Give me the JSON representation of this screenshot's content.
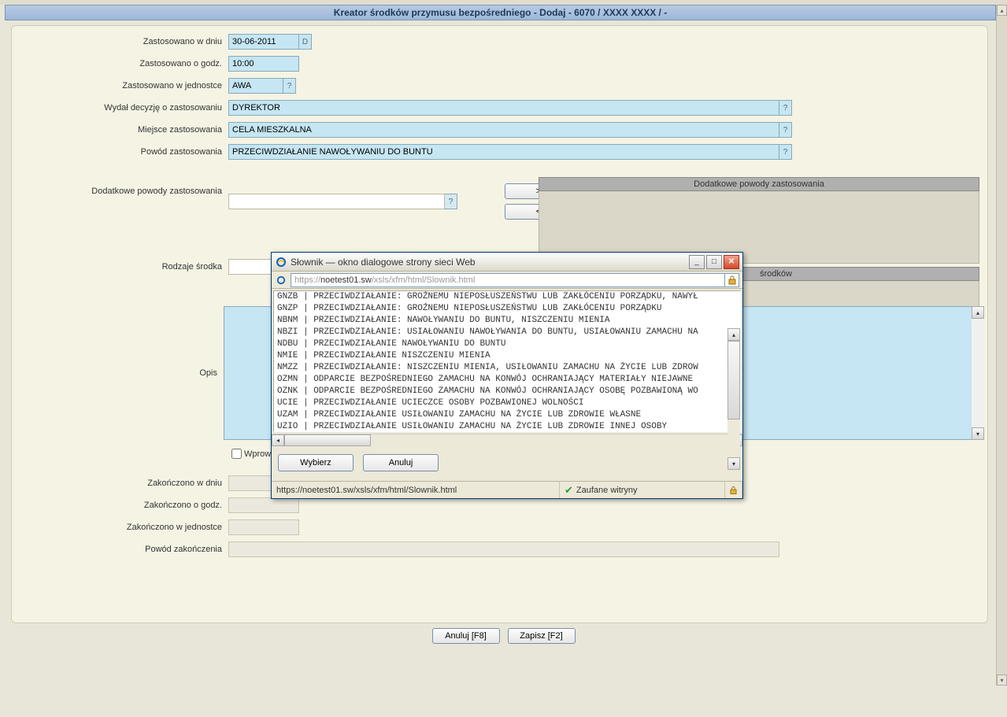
{
  "title": "Kreator środków przymusu bezpośredniego - Dodaj - 6070 / XXXX XXXX / -",
  "form": {
    "zastosowano_dniu": {
      "label": "Zastosowano w dniu",
      "value": "30-06-2011",
      "btn": "D"
    },
    "zastosowano_godz": {
      "label": "Zastosowano o godz.",
      "value": "10:00"
    },
    "zastosowano_jedn": {
      "label": "Zastosowano w jednostce",
      "value": "AWA",
      "btn": "?"
    },
    "wydal_decyzje": {
      "label": "Wydał decyzję o zastosowaniu",
      "value": "DYREKTOR",
      "btn": "?"
    },
    "miejsce": {
      "label": "Miejsce zastosowania",
      "value": "CELA MIESZKALNA",
      "btn": "?"
    },
    "powod": {
      "label": "Powód zastosowania",
      "value": "PRZECIWDZIAŁANIE NAWOŁYWANIU DO BUNTU",
      "btn": "?"
    },
    "dodatkowe_powody": {
      "label": "Dodatkowe powody zastosowania",
      "value": "",
      "btn": "?"
    },
    "rodzaje_srodka": {
      "label": "Rodzaje środka",
      "value": ""
    },
    "opis": {
      "label": "Opis",
      "value": ""
    },
    "checkbox": {
      "label": "Wprow"
    },
    "zakonczono_dniu": {
      "label": "Zakończono w dniu",
      "value": ""
    },
    "zakonczono_godz": {
      "label": "Zakończono o godz.",
      "value": ""
    },
    "zakonczono_jedn": {
      "label": "Zakończono w jednostce",
      "value": ""
    },
    "powod_zakon": {
      "label": "Powód zakończenia",
      "value": ""
    }
  },
  "right_box1_header": "Dodatkowe powody zastosowania",
  "right_box2_header": "środków",
  "transfer": {
    "right": ">",
    "left": "<"
  },
  "buttons": {
    "anuluj": "Anuluj [F8]",
    "zapisz": "Zapisz [F2]"
  },
  "dialog": {
    "title": "Słownik — okno dialogowe strony sieci Web",
    "url_prefix": "https://",
    "url_host": "noetest01.sw",
    "url_path": "/xsls/xfm/html/Slownik.html",
    "list": [
      "GNZB | PRZECIWDZIAŁANIE: GROŹNEMU NIEPOSŁUSZEŃSTWU LUB ZAKŁÓCENIU PORZĄDKU, NAWYŁ",
      "GNZP | PRZECIWDZIAŁANIE: GROŹNEMU NIEPOSŁUSZEŃSTWU LUB ZAKŁÓCENIU PORZĄDKU",
      "NBNM | PRZECIWDZIAŁANIE: NAWOŁYWANIU DO BUNTU, NISZCZENIU MIENIA",
      "NBZI | PRZECIWDZIAŁANIE: USIAŁOWANIU NAWOŁYWANIA DO BUNTU, USIAŁOWANIU ZAMACHU NA",
      "NDBU | PRZECIWDZIAŁANIE NAWOŁYWANIU DO BUNTU",
      "NMIE | PRZECIWDZIAŁANIE NISZCZENIU MIENIA",
      "NMZZ | PRZECIWDZIAŁANIE: NISZCZENIU MIENIA, USIŁOWANIU ZAMACHU NA ŻYCIE LUB ZDROW",
      "OZMN | ODPARCIE BEZPOŚREDNIEGO ZAMACHU NA KONWÓJ OCHRANIAJĄCY MATERIAŁY NIEJAWNE",
      "OZNK | ODPARCIE BEZPOŚREDNIEGO ZAMACHU NA KONWÓJ OCHRANIAJĄCY OSOBĘ POZBAWIONĄ WO",
      "UCIE | PRZECIWDZIAŁANIE UCIECZCE OSOBY POZBAWIONEJ WOLNOŚCI",
      "UZAM | PRZECIWDZIAŁANIE USIŁOWANIU ZAMACHU NA ŻYCIE LUB ZDROWIE WŁASNE",
      "UZIO | PRZECIWDZIAŁANIE USIŁOWANIU ZAMACHU NA ŻYCIE LUB ZDROWIE INNEJ OSOBY"
    ],
    "btn_select": "Wybierz",
    "btn_cancel": "Anuluj",
    "status_url": "https://noetest01.sw/xsls/xfm/html/Slownik.html",
    "status_zone": "Zaufane witryny"
  }
}
